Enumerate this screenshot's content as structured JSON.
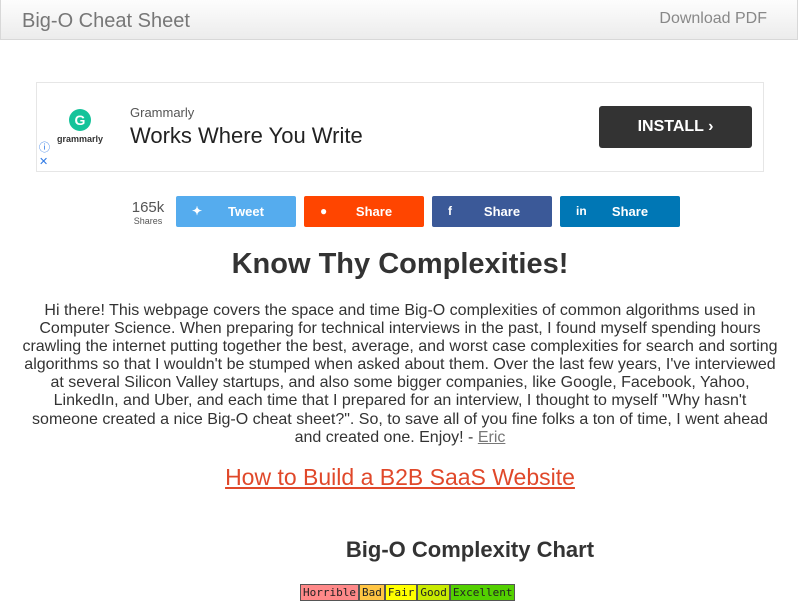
{
  "header": {
    "title": "Big-O Cheat Sheet",
    "download_label": "Download PDF"
  },
  "ad": {
    "logo_letter": "G",
    "logo_text": "grammarly",
    "sponsor": "Grammarly",
    "headline": "Works Where You Write",
    "cta": "INSTALL ›",
    "info_icon": "ⓘ",
    "close_icon": "✕"
  },
  "share": {
    "count": "165k",
    "count_label": "Shares",
    "buttons": [
      {
        "label": "Tweet",
        "icon": "twitter-icon",
        "glyph": "✦",
        "color": "#55acee"
      },
      {
        "label": "Share",
        "icon": "reddit-icon",
        "glyph": "●",
        "color": "#ff4500"
      },
      {
        "label": "Share",
        "icon": "facebook-icon",
        "glyph": "f",
        "color": "#3b5998"
      },
      {
        "label": "Share",
        "icon": "linkedin-icon",
        "glyph": "in",
        "color": "#0077b5"
      }
    ]
  },
  "main": {
    "title": "Know Thy Complexities!",
    "intro": "Hi there!  This webpage covers the space and time Big-O complexities of common algorithms used in Computer Science.  When preparing for technical interviews in the past, I found myself spending hours crawling the internet putting together the best, average, and worst case complexities for search and sorting algorithms so that I wouldn't be stumped when asked about them.  Over the last few years, I've interviewed at several Silicon Valley startups, and also some bigger companies, like Google, Facebook, Yahoo, LinkedIn, and Uber, and each time that I prepared for an interview, I thought to myself \"Why hasn't someone created a nice Big-O cheat sheet?\".  So, to save all of you fine folks a ton of time, I went ahead and created one.  Enjoy! - ",
    "author_link": "Eric",
    "promo_link": "How to Build a B2B SaaS Website",
    "chart_title": "Big-O Complexity Chart",
    "legend": [
      {
        "label": "Horrible",
        "color": "#ff8989"
      },
      {
        "label": "Bad",
        "color": "#ffc543"
      },
      {
        "label": "Fair",
        "color": "#ffff00"
      },
      {
        "label": "Good",
        "color": "#c8ea00"
      },
      {
        "label": "Excellent",
        "color": "#53d000"
      }
    ]
  }
}
